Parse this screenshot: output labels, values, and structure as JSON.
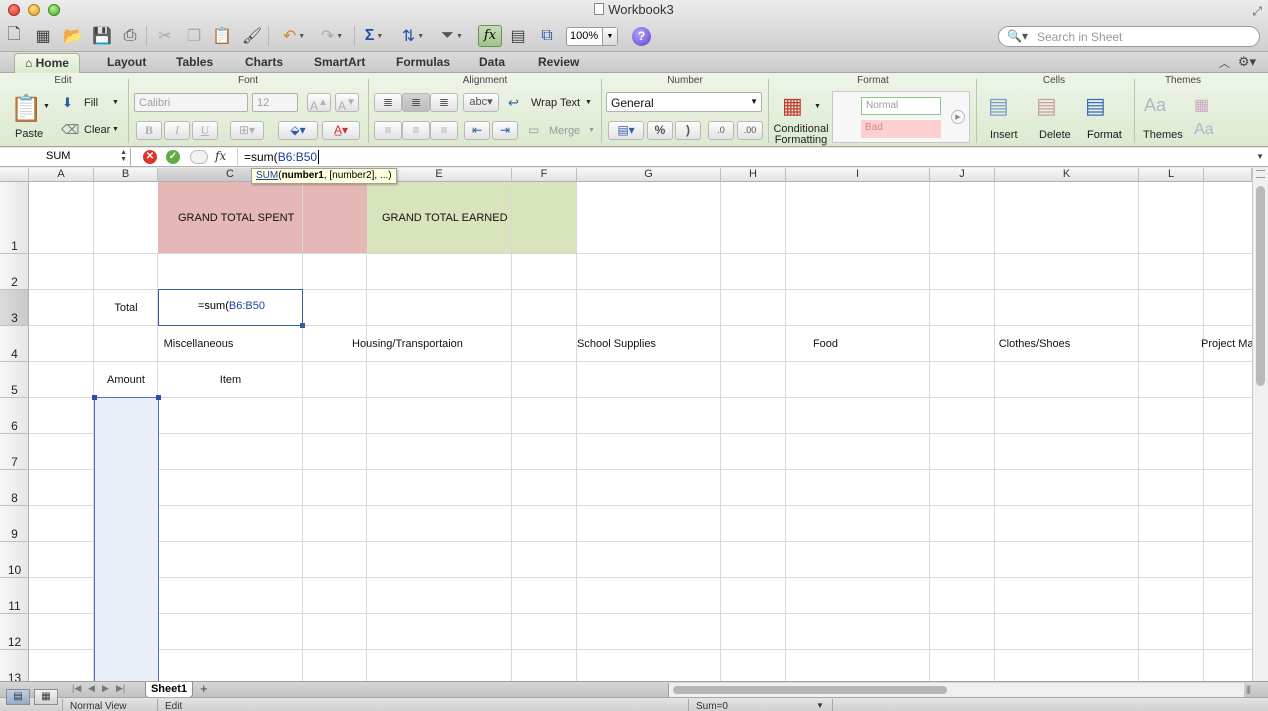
{
  "window": {
    "title": "Workbook3"
  },
  "toolbar": {
    "zoom": "100%",
    "search_placeholder": "Search in Sheet"
  },
  "ribbon": {
    "tabs": [
      "Home",
      "Layout",
      "Tables",
      "Charts",
      "SmartArt",
      "Formulas",
      "Data",
      "Review"
    ],
    "active_tab": "Home",
    "groups": {
      "edit": {
        "title": "Edit",
        "paste": "Paste",
        "fill": "Fill",
        "clear": "Clear"
      },
      "font": {
        "title": "Font",
        "name": "Calibri",
        "size": "12",
        "bold": "B",
        "italic": "I",
        "underline": "U"
      },
      "alignment": {
        "title": "Alignment",
        "wrap": "Wrap Text",
        "merge": "Merge",
        "orientation": "abc"
      },
      "number": {
        "title": "Number",
        "format": "General",
        "percent": "%",
        "comma": ")",
        "inc_decimal": ".0",
        "dec_decimal": ".00"
      },
      "format": {
        "title": "Format",
        "conditional_line1": "Conditional",
        "conditional_line2": "Formatting",
        "style_normal": "Normal",
        "style_bad": "Bad"
      },
      "cells": {
        "title": "Cells",
        "insert": "Insert",
        "delete": "Delete",
        "format": "Format"
      },
      "themes": {
        "title": "Themes",
        "themes": "Themes",
        "fonts": "Aa"
      }
    }
  },
  "formula_bar": {
    "name_box": "SUM",
    "prefix": "=sum(",
    "ref": "B6:B50",
    "tooltip": {
      "fn": "SUM",
      "arg1": "number1",
      "rest": ", [number2], ...)"
    }
  },
  "sheet": {
    "columns": [
      "A",
      "B",
      "C",
      "D",
      "E",
      "F",
      "G",
      "H",
      "I",
      "J",
      "K",
      "L"
    ],
    "selected_column": "C",
    "rows": [
      "1",
      "2",
      "3",
      "4",
      "5",
      "6",
      "7",
      "8",
      "9",
      "10",
      "11",
      "12",
      "13"
    ],
    "selected_row": "3",
    "cells": {
      "c1": "GRAND TOTAL SPENT",
      "e1": "GRAND TOTAL EARNED",
      "b3": "Total",
      "c3_prefix": "=sum(",
      "c3_ref": "B6:B50",
      "c4": "Miscellaneous",
      "e4": "Housing/Transportaion",
      "g4": "School Supplies",
      "i4": "Food",
      "k4": "Clothes/Shoes",
      "l4": "Project Ma",
      "b5": "Amount",
      "c5": "Item"
    },
    "fill_colors": {
      "spent": "#e5b8b7",
      "earned": "#d7e4bc"
    }
  },
  "tabs": {
    "sheet": "Sheet1"
  },
  "status": {
    "view": "Normal View",
    "mode": "Edit",
    "sum": "Sum=0"
  }
}
